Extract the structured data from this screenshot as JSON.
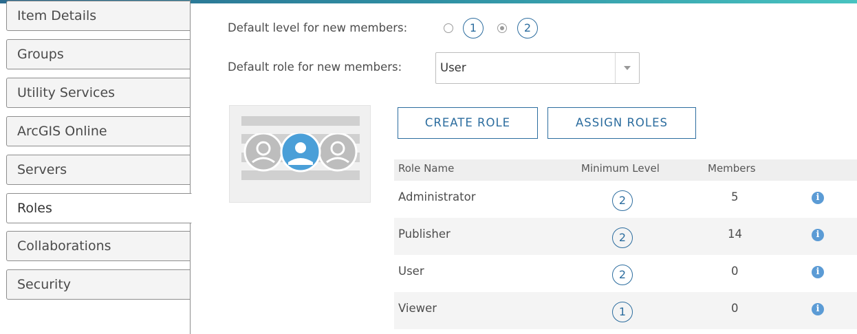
{
  "sidebar": {
    "items": [
      {
        "label": "Item Details",
        "active": false
      },
      {
        "label": "Groups",
        "active": false
      },
      {
        "label": "Utility Services",
        "active": false
      },
      {
        "label": "ArcGIS Online",
        "active": false
      },
      {
        "label": "Servers",
        "active": false
      },
      {
        "label": "Roles",
        "active": true
      },
      {
        "label": "Collaborations",
        "active": false
      },
      {
        "label": "Security",
        "active": false
      }
    ]
  },
  "defaults": {
    "level_label": "Default level for new members:",
    "level_options": [
      "1",
      "2"
    ],
    "level_selected": "2",
    "role_label": "Default role for new members:",
    "role_value": "User"
  },
  "actions": {
    "create_role": "CREATE ROLE",
    "assign_roles": "ASSIGN ROLES"
  },
  "table": {
    "headers": [
      "Role Name",
      "Minimum Level",
      "Members"
    ],
    "rows": [
      {
        "name": "Administrator",
        "level": "2",
        "members": "5"
      },
      {
        "name": "Publisher",
        "level": "2",
        "members": "14"
      },
      {
        "name": "User",
        "level": "2",
        "members": "0"
      },
      {
        "name": "Viewer",
        "level": "1",
        "members": "0"
      }
    ],
    "info_glyph": "i"
  },
  "colors": {
    "accent": "#2b6c9e",
    "info": "#5b9bd5",
    "avatar_active": "#4a9fd8",
    "avatar_inactive": "#bdbdbd"
  },
  "icons": {
    "graphic": "roles-users-icon",
    "info": "info-icon"
  }
}
